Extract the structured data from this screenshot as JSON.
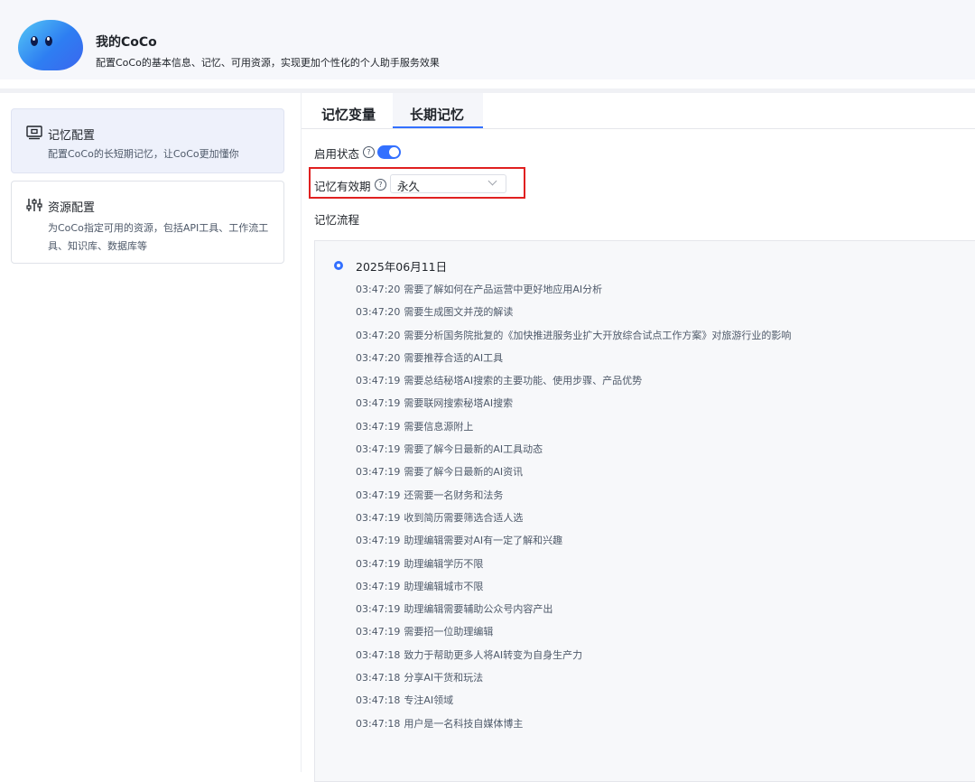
{
  "header": {
    "title": "我的CoCo",
    "subtitle": "配置CoCo的基本信息、记忆、可用资源，实现更加个性化的个人助手服务效果",
    "avatar_colors": [
      "#55c8f5",
      "#3b66ee"
    ]
  },
  "sidebar": {
    "items": [
      {
        "icon": "memory-config-icon",
        "title": "记忆配置",
        "desc": "配置CoCo的长短期记忆，让CoCo更加懂你",
        "active": true
      },
      {
        "icon": "sliders-icon",
        "title": "资源配置",
        "desc": "为CoCo指定可用的资源，包括API工具、工作流工具、知识库、数据库等",
        "active": false
      }
    ]
  },
  "tabs": [
    {
      "label": "记忆变量",
      "active": false
    },
    {
      "label": "长期记忆",
      "active": true
    }
  ],
  "settings": {
    "enable_label": "启用状态",
    "enabled": true,
    "validity_label": "记忆有效期",
    "validity_value": "永久",
    "flow_label": "记忆流程"
  },
  "timeline": {
    "date": "2025年06月11日",
    "entries": [
      {
        "time": "03:47:20",
        "text": "需要了解如何在产品运营中更好地应用AI分析"
      },
      {
        "time": "03:47:20",
        "text": "需要生成图文并茂的解读"
      },
      {
        "time": "03:47:20",
        "text": "需要分析国务院批复的《加快推进服务业扩大开放综合试点工作方案》对旅游行业的影响"
      },
      {
        "time": "03:47:20",
        "text": "需要推荐合适的AI工具"
      },
      {
        "time": "03:47:19",
        "text": "需要总结秘塔AI搜索的主要功能、使用步骤、产品优势"
      },
      {
        "time": "03:47:19",
        "text": "需要联网搜索秘塔AI搜索"
      },
      {
        "time": "03:47:19",
        "text": "需要信息源附上"
      },
      {
        "time": "03:47:19",
        "text": "需要了解今日最新的AI工具动态"
      },
      {
        "time": "03:47:19",
        "text": "需要了解今日最新的AI资讯"
      },
      {
        "time": "03:47:19",
        "text": "还需要一名财务和法务"
      },
      {
        "time": "03:47:19",
        "text": "收到简历需要筛选合适人选"
      },
      {
        "time": "03:47:19",
        "text": "助理编辑需要对AI有一定了解和兴趣"
      },
      {
        "time": "03:47:19",
        "text": "助理编辑学历不限"
      },
      {
        "time": "03:47:19",
        "text": "助理编辑城市不限"
      },
      {
        "time": "03:47:19",
        "text": "助理编辑需要辅助公众号内容产出"
      },
      {
        "time": "03:47:19",
        "text": "需要招一位助理编辑"
      },
      {
        "time": "03:47:18",
        "text": "致力于帮助更多人将AI转变为自身生产力"
      },
      {
        "time": "03:47:18",
        "text": "分享AI干货和玩法"
      },
      {
        "time": "03:47:18",
        "text": "专注AI领域"
      },
      {
        "time": "03:47:18",
        "text": "用户是一名科技自媒体博主"
      }
    ]
  },
  "colors": {
    "accent": "#3370ff",
    "highlight": "#e02020"
  }
}
